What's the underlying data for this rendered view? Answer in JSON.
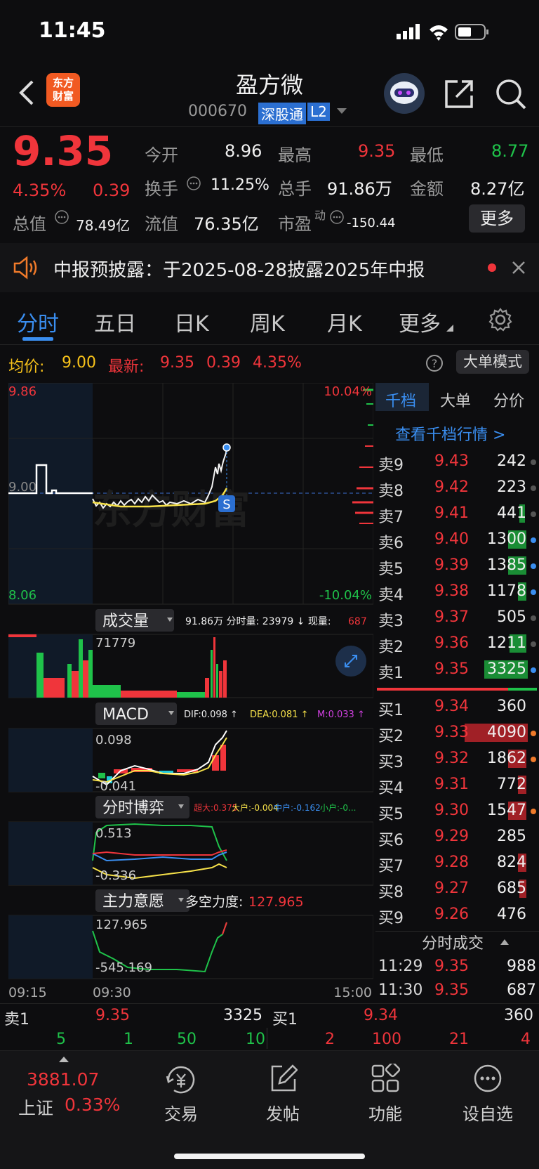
{
  "status": {
    "time": "11:45"
  },
  "header": {
    "logo_line1": "东方",
    "logo_line2": "财富",
    "stock_name": "盈方微",
    "stock_code": "000670",
    "badge_connect": "深股通",
    "badge_level": "L2"
  },
  "quote": {
    "price": "9.35",
    "change_pct": "4.35%",
    "change_abs": "0.39",
    "open_label": "今开",
    "open_value": "8.96",
    "high_label": "最高",
    "high_value": "9.35",
    "low_label": "最低",
    "low_value": "8.77",
    "turnover_label": "换手",
    "turnover_value": "11.25%",
    "volume_label": "总手",
    "volume_value": "91.86万",
    "amount_label": "金额",
    "amount_value": "8.27亿",
    "mktcap_label": "总值",
    "mktcap_value": "78.49亿",
    "float_label": "流值",
    "float_value": "76.35亿",
    "pe_label": "市盈",
    "pe_sup": "动",
    "pe_value": "-150.44",
    "more_button": "更多"
  },
  "notice": {
    "text": "中报预披露：于2025-08-28披露2025年中报"
  },
  "tabs": [
    "分时",
    "五日",
    "日K",
    "周K",
    "月K",
    "更多"
  ],
  "avgline": {
    "avg_label": "均价:",
    "avg_value": "9.00",
    "latest_label": "最新:",
    "latest_value": "9.35",
    "latest_change": "0.39",
    "latest_pct": "4.35%",
    "mode_button": "大单模式"
  },
  "price_chart": {
    "y_top": "9.86",
    "y_mid": "9.00",
    "y_bottom": "8.06",
    "pct_top": "10.04%",
    "pct_bottom": "-10.04%",
    "marker": "S",
    "watermark": "东方财富"
  },
  "volume_panel": {
    "dropdown": "成交量",
    "info": "91.86万 分时量: 23979 ↓ 现量: ",
    "current": "687",
    "max": "71779"
  },
  "macd_panel": {
    "dropdown": "MACD",
    "dif": "DIF:0.098 ↑",
    "dea": "DEA:0.081 ↑",
    "m": "M:0.033 ↑",
    "top": "0.098",
    "bottom": "-0.041"
  },
  "game_panel": {
    "dropdown": "分时博弈",
    "super": "超大:0.375",
    "big": "大户:-0.004",
    "mid": "中户:-0.162",
    "small": "小户:-0...",
    "top": "0.513",
    "bottom": "-0.336"
  },
  "main_panel": {
    "dropdown": "主力意愿",
    "label": "多空力度:",
    "value": "127.965",
    "top": "127.965",
    "bottom": "-545.169"
  },
  "time_axis": {
    "start": "09:15",
    "open": "09:30",
    "end": "15:00"
  },
  "orderbook": {
    "tabs": [
      "千档",
      "大单",
      "分价"
    ],
    "link": "查看千档行情 >",
    "asks": [
      {
        "label": "卖9",
        "price": "9.43",
        "vol": "242"
      },
      {
        "label": "卖8",
        "price": "9.42",
        "vol": "223"
      },
      {
        "label": "卖7",
        "price": "9.41",
        "vol": "441"
      },
      {
        "label": "卖6",
        "price": "9.40",
        "vol": "1300"
      },
      {
        "label": "卖5",
        "price": "9.39",
        "vol": "1385"
      },
      {
        "label": "卖4",
        "price": "9.38",
        "vol": "1178"
      },
      {
        "label": "卖3",
        "price": "9.37",
        "vol": "505"
      },
      {
        "label": "卖2",
        "price": "9.36",
        "vol": "1211"
      },
      {
        "label": "卖1",
        "price": "9.35",
        "vol": "3325"
      }
    ],
    "bids": [
      {
        "label": "买1",
        "price": "9.34",
        "vol": "360"
      },
      {
        "label": "买2",
        "price": "9.33",
        "vol": "4090"
      },
      {
        "label": "买3",
        "price": "9.32",
        "vol": "1862"
      },
      {
        "label": "买4",
        "price": "9.31",
        "vol": "772"
      },
      {
        "label": "买5",
        "price": "9.30",
        "vol": "1547"
      },
      {
        "label": "买6",
        "price": "9.29",
        "vol": "285"
      },
      {
        "label": "买7",
        "price": "9.28",
        "vol": "824"
      },
      {
        "label": "买8",
        "price": "9.27",
        "vol": "685"
      },
      {
        "label": "买9",
        "price": "9.26",
        "vol": "476"
      }
    ],
    "trades_title": "分时成交",
    "trades": [
      {
        "time": "11:29",
        "price": "9.35",
        "vol": "988"
      },
      {
        "time": "11:30",
        "price": "9.35",
        "vol": "687"
      }
    ]
  },
  "bottom_quote": {
    "ask_label": "卖1",
    "ask_price": "9.35",
    "ask_vol": "3325",
    "bid_label": "买1",
    "bid_price": "9.34",
    "bid_vol": "360",
    "ask_queue": [
      "5",
      "1",
      "50",
      "10"
    ],
    "bid_queue": [
      "2",
      "100",
      "21",
      "4"
    ]
  },
  "bottom_nav": {
    "index_value": "3881.07",
    "index_name": "上证",
    "index_pct": "0.33%",
    "items": [
      "交易",
      "发帖",
      "功能",
      "设自选"
    ]
  }
}
